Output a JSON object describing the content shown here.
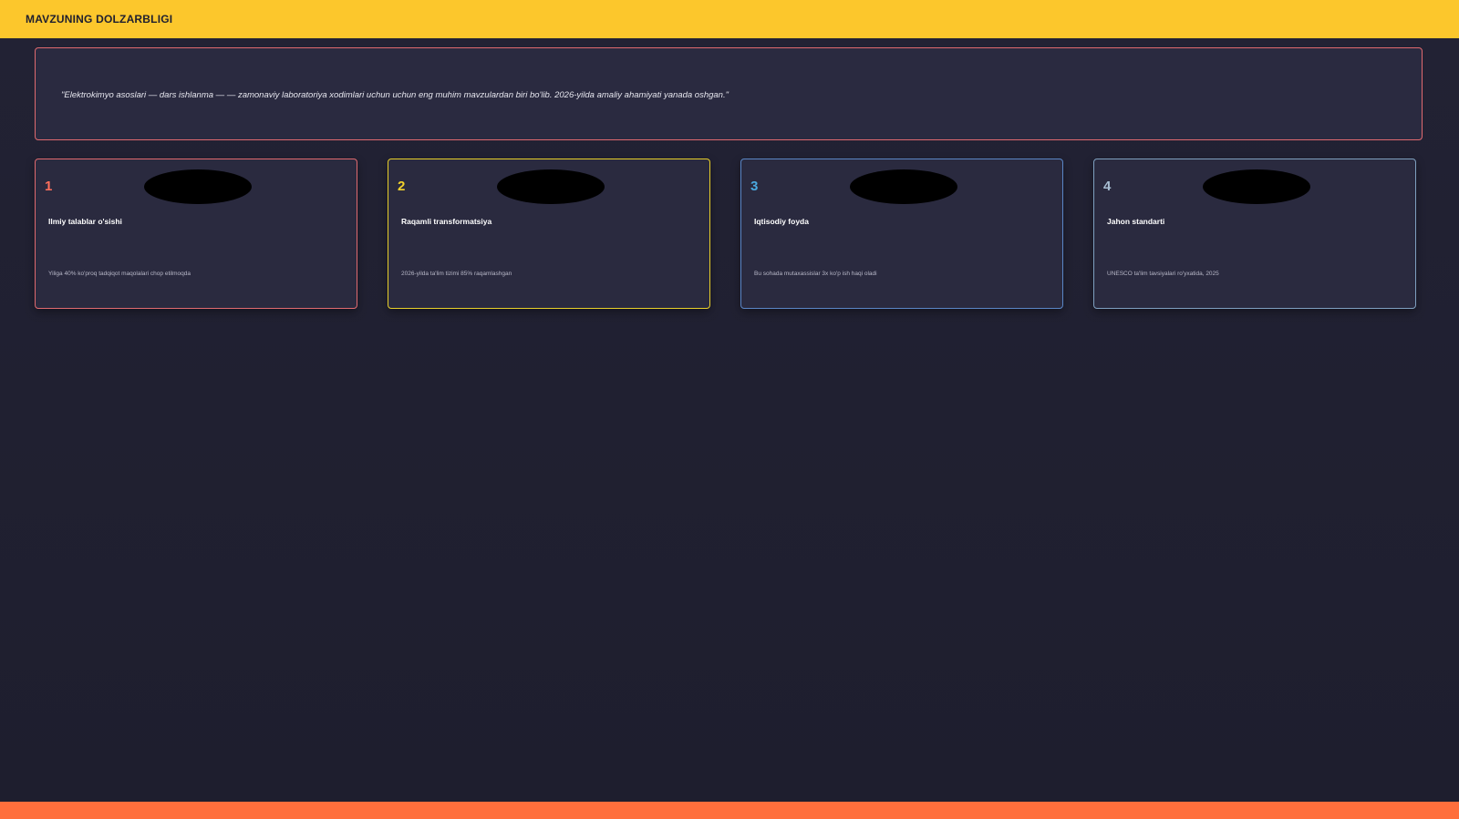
{
  "header": {
    "title": "MAVZUNING DOLZARBLIGI"
  },
  "quote": {
    "text": "\"Elektrokimyo asoslari — dars ishlanma — — zamonaviy laboratoriya xodimlari uchun uchun eng muhim mavzulardan biri bo'lib. 2026-yilda amaliy ahamiyati yanada oshgan.\""
  },
  "cards": [
    {
      "number": "1",
      "title": "Ilmiy talablar o'sishi",
      "description": "Yiliga 40% ko'proq tadqiqot maqolalari chop etilmoqda"
    },
    {
      "number": "2",
      "title": "Raqamli transformatsiya",
      "description": "2026-yilda ta'lim tizimi 85% raqamlashgan"
    },
    {
      "number": "3",
      "title": "Iqtisodiy foyda",
      "description": "Bu sohada mutaxassislar 3x ko'p ish haqi oladi"
    },
    {
      "number": "4",
      "title": "Jahon standarti",
      "description": "UNESCO ta'lim tavsiyalari ro'yxatida, 2025"
    }
  ],
  "colors": {
    "header_bar": "#fcc72c",
    "footer_bar": "#ff6f3c",
    "background": "#1f1f2f",
    "card_1_accent": "#ff6f5c",
    "card_2_accent": "#f2d12c",
    "card_3_accent": "#4aa9e0",
    "card_4_accent": "#a7bdd2"
  }
}
